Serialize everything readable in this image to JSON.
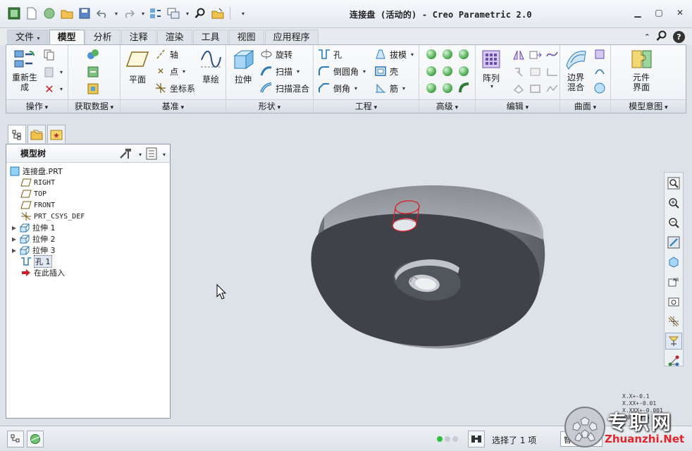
{
  "window": {
    "title": "连接盘 (活动的) - Creo Parametric 2.0"
  },
  "tabs": [
    {
      "label": "文件",
      "dropdown": true
    },
    {
      "label": "模型",
      "active": true
    },
    {
      "label": "分析"
    },
    {
      "label": "注释"
    },
    {
      "label": "渲染"
    },
    {
      "label": "工具"
    },
    {
      "label": "视图"
    },
    {
      "label": "应用程序"
    }
  ],
  "ribbon": {
    "groups": {
      "operations": "操作",
      "get_data": "获取数据",
      "datum": "基准",
      "shapes": "形状",
      "engineering": "工程",
      "advanced": "高级",
      "editing": "编辑",
      "surfaces": "曲面",
      "model_intent": "模型意图"
    },
    "buttons": {
      "regenerate": "重新生\n成",
      "plane": "平面",
      "axis": "轴",
      "point": "点",
      "csys": "坐标系",
      "sketch": "草绘",
      "extrude": "拉伸",
      "revolve": "旋转",
      "sweep": "扫描",
      "swept_blend": "扫描混合",
      "hole": "孔",
      "round": "倒圆角",
      "chamfer": "倒角",
      "draft": "拔模",
      "shell": "壳",
      "rib": "筋",
      "pattern": "阵列",
      "boundary_blend": "边界\n混合",
      "component_interface": "元件\n界面"
    }
  },
  "model_tree": {
    "header": "模型树",
    "items": [
      {
        "label": "连接盘.PRT",
        "icon": "part-icon",
        "expandable": false
      },
      {
        "label": "RIGHT",
        "icon": "datum-plane-icon",
        "expandable": false
      },
      {
        "label": "TOP",
        "icon": "datum-plane-icon",
        "expandable": false
      },
      {
        "label": "FRONT",
        "icon": "datum-plane-icon",
        "expandable": false
      },
      {
        "label": "PRT_CSYS_DEF",
        "icon": "csys-icon",
        "expandable": false
      },
      {
        "label": "拉伸 1",
        "icon": "extrude-icon",
        "expandable": true
      },
      {
        "label": "拉伸 2",
        "icon": "extrude-icon",
        "expandable": true
      },
      {
        "label": "拉伸 3",
        "icon": "extrude-icon",
        "expandable": true
      },
      {
        "label": "孔 1",
        "icon": "hole-icon",
        "expandable": false,
        "selected": true
      },
      {
        "label": "在此插入",
        "icon": "insert-here-arrow-icon",
        "expandable": false
      }
    ]
  },
  "graphics": {
    "dimension_legend": [
      "X.X+-0.1",
      "X.XX+-0.01",
      "X.XXX+-0.001",
      "ANG+-0.5"
    ]
  },
  "status": {
    "selection_text": "选择了 1 项",
    "filter_value": "智"
  },
  "watermark": {
    "text": "专职网",
    "url": "Zhuanzhi.Net"
  },
  "colors": {
    "accent": "#2f63b6",
    "hole_highlight": "#d4202a",
    "part_face": "#3f4349",
    "part_rim": "#8c9096"
  }
}
